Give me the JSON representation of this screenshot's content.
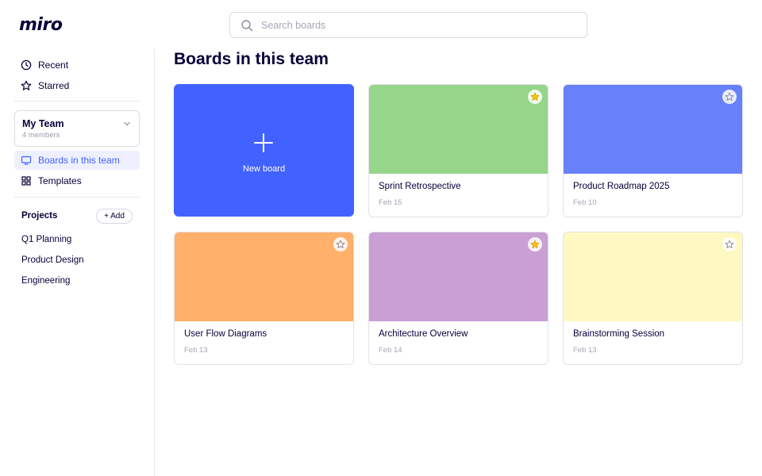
{
  "app": {
    "logo": "miro"
  },
  "search": {
    "placeholder": "Search boards"
  },
  "sidebar": {
    "nav": [
      {
        "label": "Recent",
        "icon": "clock-icon"
      },
      {
        "label": "Starred",
        "icon": "star-icon"
      }
    ],
    "team": {
      "name": "My Team",
      "members": "4 members"
    },
    "team_nav": [
      {
        "label": "Boards in this team",
        "icon": "monitor-icon",
        "active": true
      },
      {
        "label": "Templates",
        "icon": "grid-icon",
        "active": false
      }
    ],
    "projects": {
      "heading": "Projects",
      "add_label": "+ Add",
      "items": [
        "Q1 Planning",
        "Product Design",
        "Engineering"
      ]
    }
  },
  "main": {
    "title": "Boards in this team",
    "new_board_label": "New board",
    "boards": [
      {
        "name": "Sprint Retrospective",
        "date": "Feb 15",
        "color": "#96d58a",
        "starred": true
      },
      {
        "name": "Product Roadmap 2025",
        "date": "Feb 10",
        "color": "#6781f9",
        "starred": false
      },
      {
        "name": "User Flow Diagrams",
        "date": "Feb 13",
        "color": "#ffb06b",
        "starred": false
      },
      {
        "name": "Architecture Overview",
        "date": "Feb 14",
        "color": "#c99fd4",
        "starred": true
      },
      {
        "name": "Brainstorming Session",
        "date": "Feb 13",
        "color": "#fff9c1",
        "starred": false
      }
    ]
  },
  "colors": {
    "accent": "#4262ff",
    "star_filled": "#f5c518",
    "text": "#050038"
  }
}
